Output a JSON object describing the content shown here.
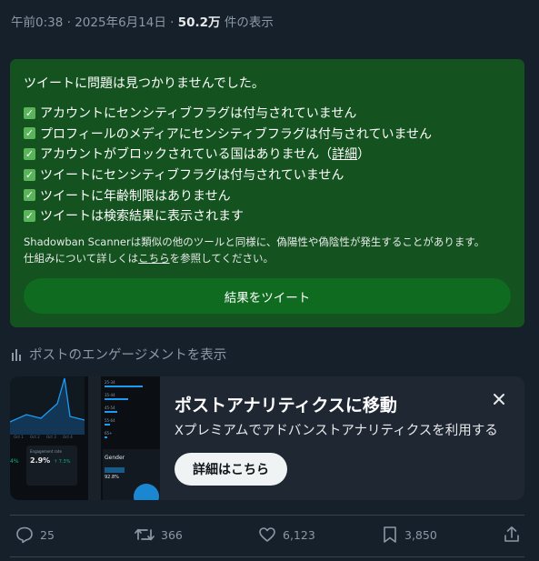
{
  "meta": {
    "time": "午前0:38",
    "sep": "·",
    "date": "2025年6月14日",
    "views_count": "50.2万",
    "views_label": "件の表示"
  },
  "scanner": {
    "title": "ツイートに問題は見つかりませんでした。",
    "checks": [
      {
        "text": "アカウントにセンシティブフラグは付与されていません"
      },
      {
        "text": "プロフィールのメディアにセンシティブフラグは付与されていません"
      },
      {
        "text": "アカウントがブロックされている国はありません（",
        "link": "詳細",
        "suffix": "）"
      },
      {
        "text": "ツイートにセンシティブフラグは付与されていません"
      },
      {
        "text": "ツイートに年齢制限はありません"
      },
      {
        "text": "ツイートは検索結果に表示されます"
      }
    ],
    "note_line1": "Shadowban Scannerは類似の他のツールと同様に、偽陽性や偽陰性が発生することがあります。",
    "note_line2_pre": "仕組みについて詳しくは",
    "note_link": "こちら",
    "note_line2_post": "を参照してください。",
    "button_label": "結果をツイート",
    "accent": "#14521f"
  },
  "engagement": {
    "label": "ポストのエンゲージメントを表示",
    "icon": "bar-chart-icon"
  },
  "promo": {
    "title": "ポストアナリティクスに移動",
    "subtitle": "Xプレミアムでアドバンストアナリティクスを利用する",
    "button_label": "詳細はこちら",
    "close_icon": "close-icon",
    "thumb": {
      "rows": [
        "25-34",
        "35-44",
        "45-54",
        "55-64",
        "65+"
      ],
      "engagement_label": "Engagement rate",
      "engagement_value": "2.9%",
      "engagement_delta": "↑ 7.3%",
      "side_value": "4%",
      "gender_label": "Gender",
      "gender_value": "92.8%",
      "axis_labels": [
        "Oct 1",
        "Oct 2",
        "Oct 3",
        "Oct 4"
      ]
    }
  },
  "actions": {
    "replies": "25",
    "reposts": "366",
    "likes": "6,123",
    "bookmarks": "3,850"
  }
}
